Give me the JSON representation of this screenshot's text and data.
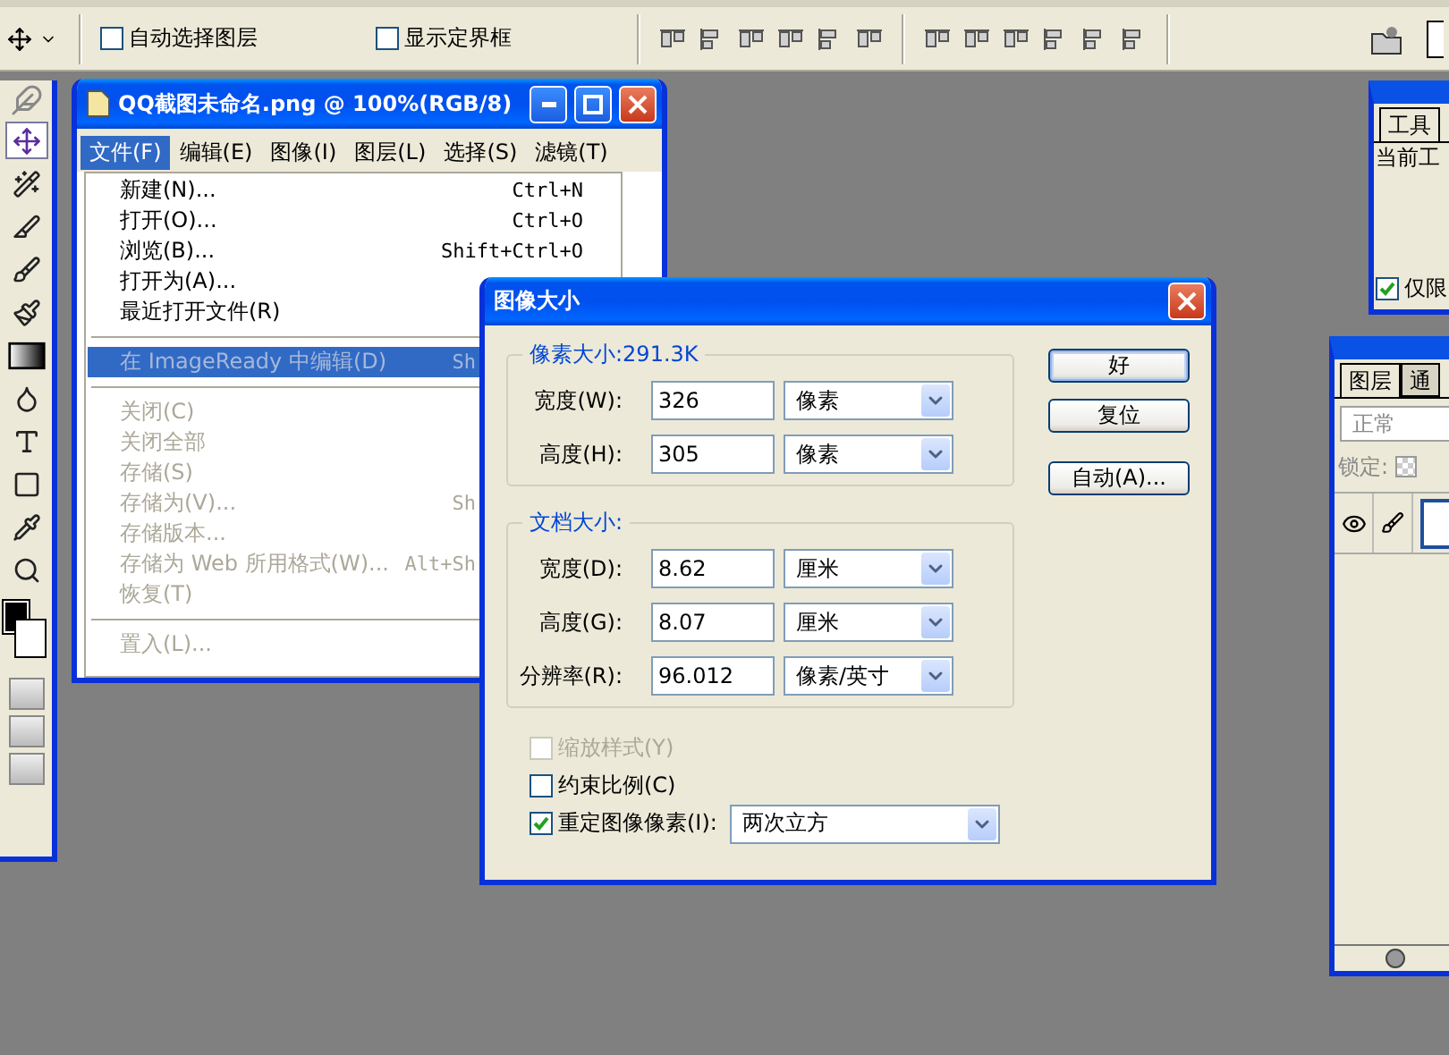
{
  "options_bar": {
    "checkboxes": [
      {
        "label": "自动选择图层",
        "checked": false
      },
      {
        "label": "显示定界框",
        "checked": false
      }
    ]
  },
  "toolbox": {
    "tools": [
      {
        "kind": "move",
        "selected": true
      },
      {
        "kind": "wand",
        "selected": false
      },
      {
        "kind": "slice",
        "selected": false
      },
      {
        "kind": "brush",
        "selected": false
      },
      {
        "kind": "history",
        "selected": false
      },
      {
        "kind": "gradient",
        "selected": false
      },
      {
        "kind": "blur",
        "selected": false
      },
      {
        "kind": "type",
        "selected": false
      },
      {
        "kind": "shape",
        "selected": false
      },
      {
        "kind": "eyedropper",
        "selected": false
      },
      {
        "kind": "zoom",
        "selected": false
      }
    ]
  },
  "document_window": {
    "title": "QQ截图未命名.png @ 100%(RGB/8)",
    "menu": [
      {
        "label": "文件(F)",
        "selected": true
      },
      {
        "label": "编辑(E)",
        "selected": false
      },
      {
        "label": "图像(I)",
        "selected": false
      },
      {
        "label": "图层(L)",
        "selected": false
      },
      {
        "label": "选择(S)",
        "selected": false
      },
      {
        "label": "滤镜(T)",
        "selected": false
      }
    ],
    "file_menu": [
      {
        "kind": "item",
        "label": "新建(N)...",
        "shortcut": "Ctrl+N",
        "disabled": false,
        "selected": false
      },
      {
        "kind": "item",
        "label": "打开(O)...",
        "shortcut": "Ctrl+O",
        "disabled": false,
        "selected": false
      },
      {
        "kind": "item",
        "label": "浏览(B)...",
        "shortcut": "Shift+Ctrl+O",
        "disabled": false,
        "selected": false
      },
      {
        "kind": "item",
        "label": "打开为(A)...",
        "disabled": false,
        "selected": false
      },
      {
        "kind": "item",
        "label": "最近打开文件(R)",
        "disabled": false,
        "selected": false
      },
      {
        "kind": "separator"
      },
      {
        "kind": "item",
        "label": "在 ImageReady 中编辑(D)",
        "shortcut": "Sh",
        "disabled": true,
        "selected": true
      },
      {
        "kind": "separator"
      },
      {
        "kind": "item",
        "label": "关闭(C)",
        "disabled": true,
        "selected": false
      },
      {
        "kind": "item",
        "label": "关闭全部",
        "disabled": true,
        "selected": false
      },
      {
        "kind": "item",
        "label": "存储(S)",
        "disabled": true,
        "selected": false
      },
      {
        "kind": "item",
        "label": "存储为(V)...",
        "shortcut": "Sh",
        "disabled": true,
        "selected": false
      },
      {
        "kind": "item",
        "label": "存储版本...",
        "disabled": true,
        "selected": false
      },
      {
        "kind": "item",
        "label": "存储为 Web 所用格式(W)...",
        "shortcut": "Alt+Sh",
        "disabled": true,
        "selected": false
      },
      {
        "kind": "item",
        "label": "恢复(T)",
        "disabled": true,
        "selected": false
      },
      {
        "kind": "separator"
      },
      {
        "kind": "item",
        "label": "置入(L)...",
        "disabled": true,
        "selected": false
      }
    ]
  },
  "dialog": {
    "title": "图像大小",
    "groups": [
      {
        "title": "像素大小:291.3K",
        "fields": [
          {
            "label": "宽度(W):",
            "value": "326",
            "unit": "像素"
          },
          {
            "label": "高度(H):",
            "value": "305",
            "unit": "像素"
          }
        ]
      },
      {
        "title": "文档大小:",
        "fields": [
          {
            "label": "宽度(D):",
            "value": "8.62",
            "unit": "厘米"
          },
          {
            "label": "高度(G):",
            "value": "8.07",
            "unit": "厘米"
          },
          {
            "label": "分辨率(R):",
            "value": "96.012",
            "unit": "像素/英寸"
          }
        ]
      }
    ],
    "options": [
      {
        "label": "缩放样式(Y)",
        "checked": false,
        "disabled": true
      },
      {
        "label": "约束比例(C)",
        "checked": false,
        "disabled": false
      },
      {
        "label": "重定图像像素(I):",
        "checked": true,
        "disabled": false
      }
    ],
    "resample": "两次立方",
    "buttons": [
      {
        "label": "好",
        "default": true
      },
      {
        "label": "复位",
        "default": false
      },
      {
        "label": "自动(A)...",
        "default": false
      }
    ]
  },
  "tool_presets_panel": {
    "tab": "工具",
    "text": "当前工",
    "checkbox": {
      "label": "仅限",
      "checked": true
    }
  },
  "layers_panel": {
    "tabs": [
      {
        "label": "图层",
        "selected": true
      },
      {
        "label": "通",
        "selected": false
      }
    ],
    "blend_mode": "正常",
    "lock_label": "锁定:",
    "layer": {
      "visible": true
    }
  }
}
